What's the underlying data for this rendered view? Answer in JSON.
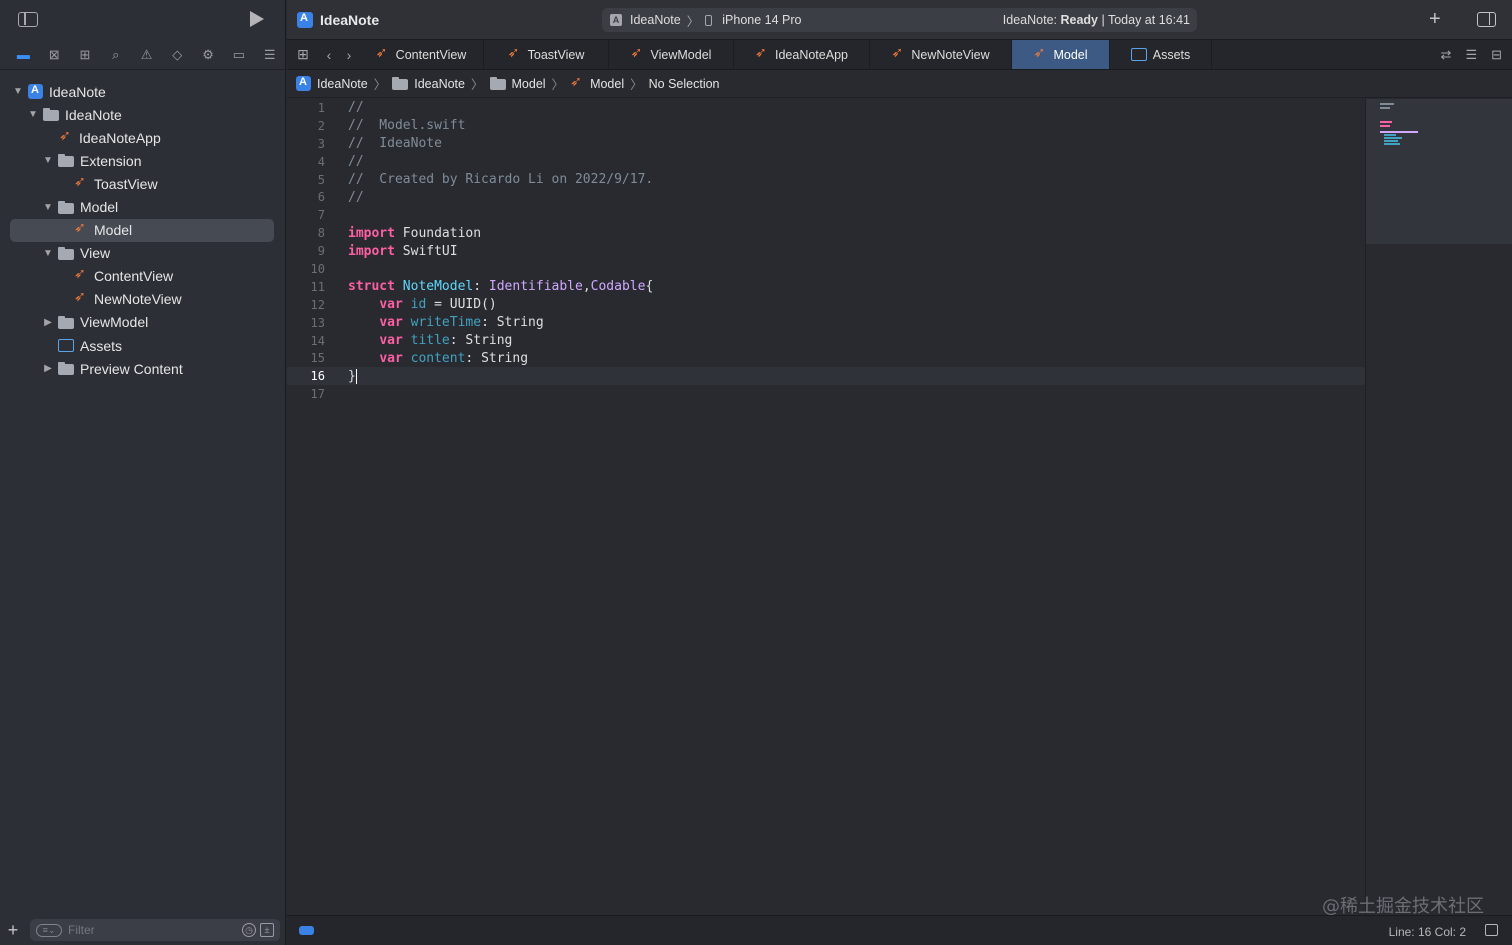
{
  "toolbar": {
    "project_title": "IdeaNote",
    "scheme": {
      "target": "IdeaNote",
      "device": "iPhone 14 Pro",
      "status_prefix": "IdeaNote: ",
      "status_state": "Ready",
      "status_suffix": " | Today at 16:41"
    }
  },
  "sidebar": {
    "tree": [
      {
        "label": "IdeaNote",
        "icon": "project-icon",
        "chevron": "v"
      },
      {
        "label": "IdeaNote",
        "icon": "folder-icon",
        "chevron": "v"
      },
      {
        "label": "IdeaNoteApp",
        "icon": "swift-file-icon",
        "chevron": ""
      },
      {
        "label": "Extension",
        "icon": "folder-icon",
        "chevron": "v"
      },
      {
        "label": "ToastView",
        "icon": "swift-file-icon",
        "chevron": ""
      },
      {
        "label": "Model",
        "icon": "folder-icon",
        "chevron": "v"
      },
      {
        "label": "Model",
        "icon": "swift-file-icon",
        "chevron": "",
        "selected": true
      },
      {
        "label": "View",
        "icon": "folder-icon",
        "chevron": "v"
      },
      {
        "label": "ContentView",
        "icon": "swift-file-icon",
        "chevron": ""
      },
      {
        "label": "NewNoteView",
        "icon": "swift-file-icon",
        "chevron": ""
      },
      {
        "label": "ViewModel",
        "icon": "folder-icon",
        "chevron": ">"
      },
      {
        "label": "Assets",
        "icon": "assets-icon",
        "chevron": ""
      },
      {
        "label": "Preview Content",
        "icon": "folder-icon",
        "chevron": ">"
      }
    ],
    "filter_placeholder": "Filter"
  },
  "tabs": [
    {
      "label": "ContentView",
      "icon": "swift-file-icon"
    },
    {
      "label": "ToastView",
      "icon": "swift-file-icon"
    },
    {
      "label": "ViewModel",
      "icon": "swift-file-icon"
    },
    {
      "label": "IdeaNoteApp",
      "icon": "swift-file-icon"
    },
    {
      "label": "NewNoteView",
      "icon": "swift-file-icon"
    },
    {
      "label": "Model",
      "icon": "swift-file-icon",
      "active": true
    },
    {
      "label": "Assets",
      "icon": "assets-icon"
    }
  ],
  "breadcrumb": [
    "IdeaNote",
    "IdeaNote",
    "Model",
    "Model",
    "No Selection"
  ],
  "editor": {
    "current_line": 16,
    "lines": [
      "//",
      "//  Model.swift",
      "//  IdeaNote",
      "//",
      "//  Created by Ricardo Li on 2022/9/17.",
      "//",
      "",
      "import Foundation",
      "import SwiftUI",
      "",
      "struct NoteModel: Identifiable,Codable{",
      "    var id = UUID()",
      "    var writeTime: String",
      "    var title: String",
      "    var content: String",
      "}",
      ""
    ]
  },
  "statusbar": {
    "position": "Line: 16  Col: 2"
  },
  "watermark": "@稀土掘金技术社区",
  "colors": {
    "accent": "#3b82e6",
    "keyword": "#fc5fa3",
    "comment": "#7f8c98",
    "type": "#5dd8ff",
    "swift_orange": "#f0793d"
  }
}
